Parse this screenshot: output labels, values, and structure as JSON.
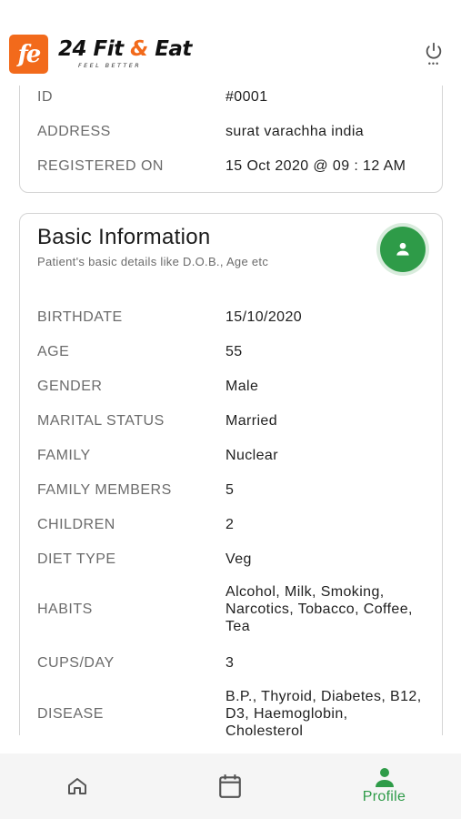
{
  "header": {
    "logo_mark": "fe",
    "brand_part1": "24 Fit ",
    "brand_amp": "&",
    "brand_part2": " Eat",
    "tagline": "FEEL BETTER",
    "power_icon": "power-icon"
  },
  "registration_card": {
    "rows": [
      {
        "label": "ID",
        "value": "#0001"
      },
      {
        "label": "ADDRESS",
        "value": "surat varachha india"
      },
      {
        "label": "REGISTERED ON",
        "value": "15 Oct 2020 @ 09 : 12 AM"
      }
    ]
  },
  "basic_info": {
    "title": "Basic Information",
    "subtitle": "Patient's basic details like D.O.B., Age etc",
    "rows": [
      {
        "label": "BIRTHDATE",
        "value": "15/10/2020"
      },
      {
        "label": "AGE",
        "value": "55"
      },
      {
        "label": "GENDER",
        "value": "Male"
      },
      {
        "label": "MARITAL STATUS",
        "value": "Married"
      },
      {
        "label": "FAMILY",
        "value": "Nuclear"
      },
      {
        "label": "FAMILY MEMBERS",
        "value": "5"
      },
      {
        "label": "CHILDREN",
        "value": "2"
      },
      {
        "label": "DIET TYPE",
        "value": "Veg"
      },
      {
        "label": "HABITS",
        "value": "Alcohol, Milk, Smoking, Narcotics, Tobacco, Coffee, Tea"
      },
      {
        "label": "CUPS/DAY",
        "value": "3"
      },
      {
        "label": "DISEASE",
        "value": "B.P., Thyroid, Diabetes, B12, D3, Haemoglobin, Cholesterol"
      }
    ]
  },
  "bottom_nav": {
    "items": [
      {
        "icon": "home-icon",
        "label": ""
      },
      {
        "icon": "calendar-icon",
        "label": ""
      },
      {
        "icon": "person-icon",
        "label": "Profile"
      }
    ],
    "active_color": "#2e9b48"
  },
  "colors": {
    "brand_orange": "#f26a1b",
    "accent_green": "#2e9b48"
  }
}
